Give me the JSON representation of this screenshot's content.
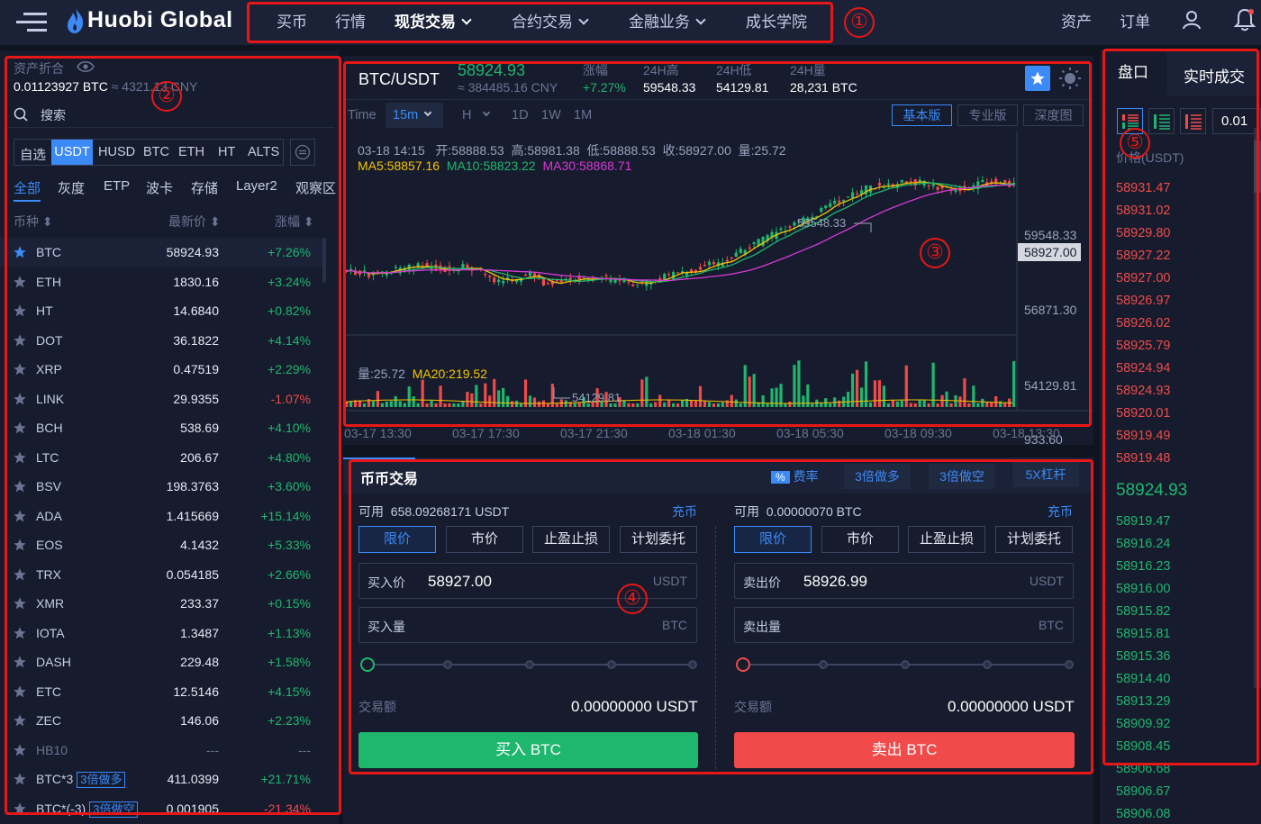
{
  "header": {
    "logo": "Huobi Global",
    "nav": [
      {
        "label": "买币"
      },
      {
        "label": "行情"
      },
      {
        "label": "现货交易"
      },
      {
        "label": "合约交易"
      },
      {
        "label": "金融业务"
      },
      {
        "label": "成长学院"
      }
    ],
    "right": {
      "assets": "资产",
      "orders": "订单"
    }
  },
  "markers": {
    "m1": "①",
    "m2": "②",
    "m3": "③",
    "m4": "④",
    "m5": "⑤"
  },
  "left": {
    "assets_label": "资产折合",
    "assets_btc": "0.01123927 BTC",
    "assets_cny": "≈ 4321.13 CNY",
    "search_placeholder": "搜索",
    "markets": [
      "自选",
      "USDT",
      "HUSD",
      "BTC",
      "ETH",
      "HT",
      "ALTS"
    ],
    "categories": [
      "全部",
      "灰度",
      "ETP",
      "波卡",
      "存储",
      "Layer2",
      "观察区"
    ],
    "col_coin": "币种",
    "col_price": "最新价",
    "col_change": "涨幅",
    "coins": [
      {
        "name": "BTC",
        "price": "58924.93",
        "change": "+7.26%",
        "dir": "up",
        "fav": true
      },
      {
        "name": "ETH",
        "price": "1830.16",
        "change": "+3.24%",
        "dir": "up"
      },
      {
        "name": "HT",
        "price": "14.6840",
        "change": "+0.82%",
        "dir": "up"
      },
      {
        "name": "DOT",
        "price": "36.1822",
        "change": "+4.14%",
        "dir": "up"
      },
      {
        "name": "XRP",
        "price": "0.47519",
        "change": "+2.29%",
        "dir": "up"
      },
      {
        "name": "LINK",
        "price": "29.9355",
        "change": "-1.07%",
        "dir": "down"
      },
      {
        "name": "BCH",
        "price": "538.69",
        "change": "+4.10%",
        "dir": "up"
      },
      {
        "name": "LTC",
        "price": "206.67",
        "change": "+4.80%",
        "dir": "up"
      },
      {
        "name": "BSV",
        "price": "198.3763",
        "change": "+3.60%",
        "dir": "up"
      },
      {
        "name": "ADA",
        "price": "1.415669",
        "change": "+15.14%",
        "dir": "up"
      },
      {
        "name": "EOS",
        "price": "4.1432",
        "change": "+5.33%",
        "dir": "up"
      },
      {
        "name": "TRX",
        "price": "0.054185",
        "change": "+2.66%",
        "dir": "up"
      },
      {
        "name": "XMR",
        "price": "233.37",
        "change": "+0.15%",
        "dir": "up"
      },
      {
        "name": "IOTA",
        "price": "1.3487",
        "change": "+1.13%",
        "dir": "up"
      },
      {
        "name": "DASH",
        "price": "229.48",
        "change": "+1.58%",
        "dir": "up"
      },
      {
        "name": "ETC",
        "price": "12.5146",
        "change": "+4.15%",
        "dir": "up"
      },
      {
        "name": "ZEC",
        "price": "146.06",
        "change": "+2.23%",
        "dir": "up"
      },
      {
        "name": "HB10",
        "price": "---",
        "change": "---",
        "dir": "none"
      },
      {
        "name": "BTC*3",
        "badge": "3倍做多",
        "price": "411.0399",
        "change": "+21.71%",
        "dir": "up"
      },
      {
        "name": "BTC*(-3)",
        "badge": "3倍做空",
        "price": "0.001905",
        "change": "-21.34%",
        "dir": "down"
      }
    ]
  },
  "ticker": {
    "pair": "BTC/USDT",
    "price": "58924.93",
    "cny": "≈ 384485.16 CNY",
    "change_label": "涨幅",
    "change": "+7.27%",
    "high_label": "24H高",
    "high": "59548.33",
    "low_label": "24H低",
    "low": "54129.81",
    "vol_label": "24H量",
    "vol": "28,231 BTC"
  },
  "chart_toolbar": {
    "time": "Time",
    "interval": "15m",
    "h": "H",
    "d": "1D",
    "w": "1W",
    "m": "1M",
    "basic": "基本版",
    "pro": "专业版",
    "depth": "深度图"
  },
  "chart_info": {
    "ohlc": "03-18 14:15   开:58888.53  高:58981.38  低:58888.53  收:58927.00  量:25.72",
    "ma5": "MA5:58857.16",
    "ma10": "MA10:58823.22",
    "ma30": "MA30:58868.71",
    "vol": "量:25.72",
    "ma20": "MA20:219.52"
  },
  "chart_data": {
    "type": "candlestick",
    "price_axis": [
      "59548.33",
      "58927.00",
      "56871.30",
      "54129.81"
    ],
    "volume_axis": [
      "933.60"
    ],
    "x_ticks": [
      "03-17 13:30",
      "03-17 17:30",
      "03-17 21:30",
      "03-18 01:30",
      "03-18 05:30",
      "03-18 09:30",
      "03-18 13:30"
    ],
    "high_marker": "59548.33",
    "low_marker": "54129.81",
    "current": "58927.00"
  },
  "trade": {
    "title": "币币交易",
    "fee_badge": "%",
    "fee": "费率",
    "lev1": "3倍做多",
    "lev2": "3倍做空",
    "lev3": "5X杠杆",
    "buy": {
      "avail_label": "可用",
      "avail": "658.09268171 USDT",
      "deposit": "充币",
      "price_label": "买入价",
      "price": "58927.00",
      "price_unit": "USDT",
      "amount_label": "买入量",
      "amount_unit": "BTC",
      "total_label": "交易额",
      "total": "0.00000000 USDT",
      "button": "买入 BTC"
    },
    "sell": {
      "avail_label": "可用",
      "avail": "0.00000070 BTC",
      "deposit": "充币",
      "price_label": "卖出价",
      "price": "58926.99",
      "price_unit": "USDT",
      "amount_label": "卖出量",
      "amount_unit": "BTC",
      "total_label": "交易额",
      "total": "0.00000000 USDT",
      "button": "卖出 BTC"
    },
    "order_types": [
      "限价",
      "市价",
      "止盈止损",
      "计划委托"
    ]
  },
  "book": {
    "tab_book": "盘口",
    "tab_trades": "实时成交",
    "precision": "0.01",
    "price_header": "价格(USDT)",
    "asks": [
      "58931.47",
      "58931.02",
      "58929.80",
      "58927.22",
      "58927.00",
      "58926.97",
      "58926.02",
      "58925.79",
      "58924.94",
      "58924.93",
      "58920.01",
      "58919.49",
      "58919.48"
    ],
    "mid": "58924.93",
    "bids": [
      "58919.47",
      "58916.24",
      "58916.23",
      "58916.00",
      "58915.82",
      "58915.81",
      "58915.36",
      "58914.40",
      "58913.29",
      "58909.92",
      "58908.45",
      "58906.68",
      "58906.67",
      "58906.08"
    ],
    "colors": {
      "up": "#1fb66e",
      "down": "#f04a4a",
      "accent": "#3b8af8"
    }
  }
}
